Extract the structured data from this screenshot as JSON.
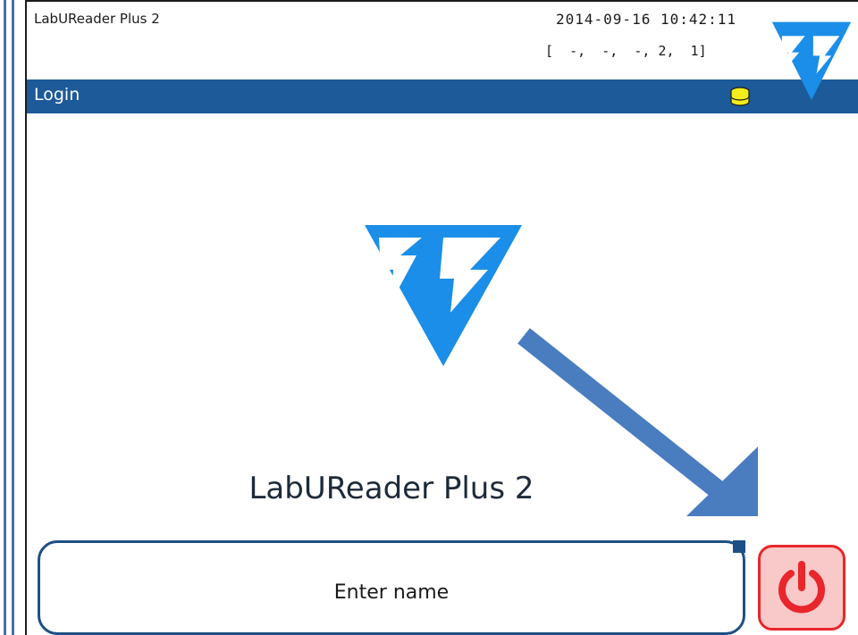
{
  "header": {
    "app_title": "LabUReader Plus 2",
    "datetime": "2014-09-16 10:42:11",
    "status": "[  -,  -,  -, 2,  1]"
  },
  "titlebar": {
    "title": "Login",
    "status_icon": "database-icon"
  },
  "main": {
    "device_name": "LabUReader Plus 2",
    "logo": "brand-logo-icon"
  },
  "login": {
    "name_placeholder": "Enter name"
  },
  "power_button": {
    "icon": "power-icon"
  },
  "colors": {
    "title_bar": "#1c5a9a",
    "logo_blue": "#1a8ee8",
    "annotation_arrow": "#4a7cc0",
    "power_red": "#e8262c",
    "power_bg": "#f9c9c9"
  }
}
